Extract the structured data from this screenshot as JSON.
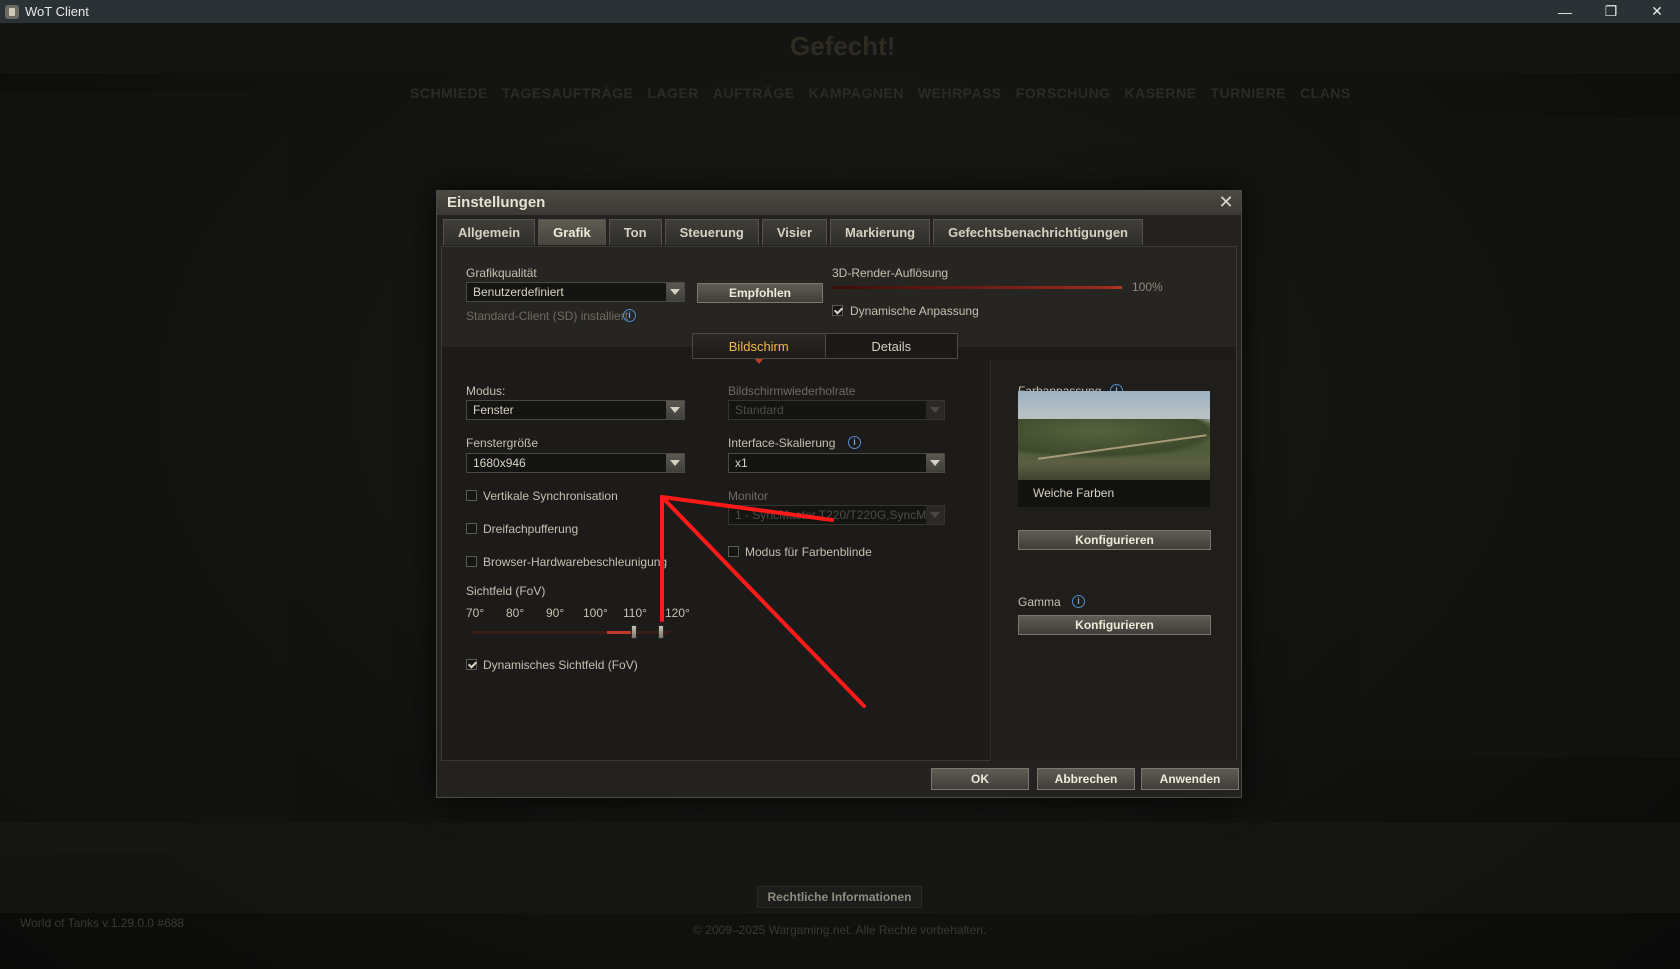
{
  "window": {
    "title": "WoT Client",
    "minimize_glyph": "—",
    "restore_glyph": "❐",
    "close_glyph": "✕"
  },
  "background": {
    "battle_button": "Gefecht!",
    "nav": [
      "SCHMIEDE",
      "TAGESAUFTRÄGE",
      "LAGER",
      "AUFTRÄGE",
      "KAMPAGNEN",
      "WEHRPASS",
      "FORSCHUNG",
      "KASERNE",
      "TURNIERE",
      "CLANS"
    ],
    "version": "World of Tanks v.1.29.0.0 #688",
    "copyright": "© 2009–2025 Wargaming.net. Alle Rechte vorbehalten.",
    "legal_button": "Rechtliche Informationen"
  },
  "dialog": {
    "title": "Einstellungen",
    "tabs": [
      "Allgemein",
      "Grafik",
      "Ton",
      "Steuerung",
      "Visier",
      "Markierung",
      "Gefechtsbenachrichtigungen"
    ],
    "active_tab": "Grafik",
    "quality": {
      "label": "Grafikqualität",
      "value": "Benutzerdefiniert",
      "recommended_button": "Empfohlen",
      "client_note": "Standard-Client (SD) installiert"
    },
    "render": {
      "label": "3D-Render-Auflösung",
      "value": "100%",
      "dynamic_label": "Dynamische Anpassung",
      "dynamic_checked": true
    },
    "subtabs": [
      "Bildschirm",
      "Details"
    ],
    "screen": {
      "mode_label": "Modus:",
      "mode_value": "Fenster",
      "window_size_label": "Fenstergröße",
      "window_size_value": "1680x946",
      "refresh_label": "Bildschirmwiederholrate",
      "refresh_value": "Standard",
      "scaling_label": "Interface-Skalierung",
      "scaling_value": "x1",
      "monitor_label": "Monitor",
      "monitor_value": "1 - SyncMaster T220/T220G,SyncM...",
      "vsync_label": "Vertikale Synchronisation",
      "triple_label": "Dreifachpufferung",
      "browser_label": "Browser-Hardwarebeschleunigung",
      "colorblind_label": "Modus für Farbenblinde",
      "fov_label": "Sichtfeld (FoV)",
      "fov_ticks": [
        "70°",
        "80°",
        "90°",
        "100°",
        "110°",
        "120°"
      ],
      "dynamic_fov_label": "Dynamisches Sichtfeld (FoV)",
      "dynamic_fov_checked": true
    },
    "color": {
      "label": "Farbanpassung",
      "preview_caption": "Weiche Farben",
      "configure_button": "Konfigurieren",
      "gamma_label": "Gamma",
      "gamma_configure_button": "Konfigurieren"
    },
    "footer": {
      "ok": "OK",
      "cancel": "Abbrechen",
      "apply": "Anwenden"
    }
  },
  "colors": {
    "accent": "#f2b749",
    "slider": "#c0392b",
    "annotation": "#ff1a1a"
  }
}
